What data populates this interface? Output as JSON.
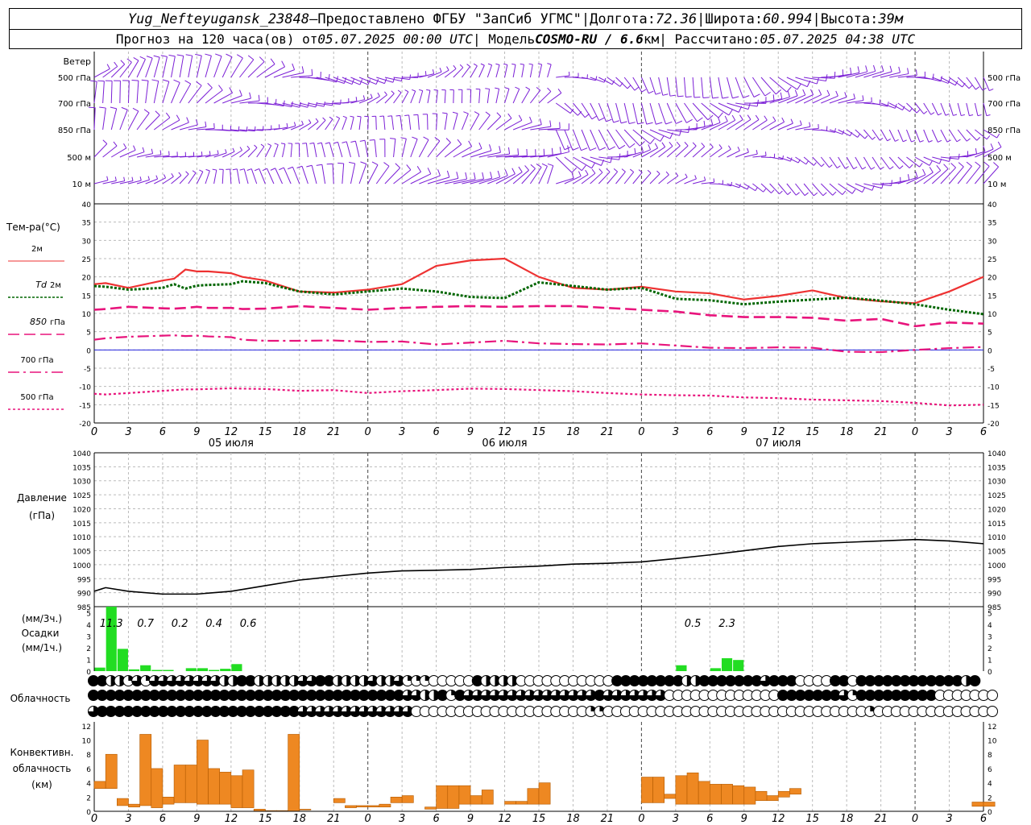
{
  "header": {
    "line1": {
      "station": "Yug_Nefteyugansk_23848",
      "dash": " – ",
      "provider": "Предоставлено ФГБУ \"ЗапСиб УГМС\"",
      "sep": " | ",
      "lon_label": "Долгота: ",
      "lon": "72.36",
      "lat_label": "Широта: ",
      "lat": "60.994",
      "alt_label": "Высота: ",
      "alt": "39м"
    },
    "line2": {
      "forecast_prefix": "Прогноз на 120 часа(ов) от ",
      "forecast_time": "05.07.2025 00:00 UTC",
      "model_prefix": "  | Модель ",
      "model": "COSMO-RU / 6.6",
      "model_unit": "км",
      "calc_prefix": " | Рассчитано: ",
      "calc_time": "05.07.2025 04:38 UTC"
    }
  },
  "colors": {
    "wind": "#7b1fd6",
    "t2m": "#ee3232",
    "td2m": "#006600",
    "t850": "#e8147c",
    "t700": "#e8147c",
    "t500": "#e8147c",
    "zero_line": "#2222dd",
    "precip": "#22dd22",
    "conv": "#ee8822"
  },
  "chart_data": {
    "type": "meteogram",
    "hour_ticks": [
      "0",
      "3",
      "6",
      "9",
      "12",
      "15",
      "18",
      "21",
      "0",
      "3",
      "6",
      "9",
      "12",
      "15",
      "18",
      "21",
      "0",
      "3",
      "6",
      "9",
      "12",
      "15",
      "18",
      "21",
      "0",
      "3",
      "6"
    ],
    "day_labels": [
      {
        "label": "05 июля",
        "hour": 12
      },
      {
        "label": "06 июля",
        "hour": 36
      },
      {
        "label": "07 июля",
        "hour": 60
      }
    ],
    "wind": {
      "title": "Ветер",
      "levels": [
        "500 гПа",
        "700 гПа",
        "850 гПа",
        "500 м",
        "10  м"
      ]
    },
    "temperature": {
      "title": "Тем-ра(°C)",
      "ylim": [
        -20,
        40
      ],
      "yticks": [
        "40",
        "35",
        "30",
        "25",
        "20",
        "15",
        "10",
        "5",
        "0",
        "-5",
        "-10",
        "-15",
        "-20"
      ],
      "legend": [
        {
          "label": "2м",
          "key": "t2m"
        },
        {
          "label_it": "Td",
          "label": "2м",
          "key": "td2m"
        },
        {
          "label_it": "850",
          "label": "гПа",
          "key": "t850"
        },
        {
          "label": "700 гПа",
          "key": "t700"
        },
        {
          "label": "500 гПа",
          "key": "t500"
        }
      ],
      "x_hours": [
        0,
        1,
        3,
        6,
        7,
        8,
        9,
        10,
        12,
        13,
        15,
        18,
        21,
        24,
        27,
        30,
        33,
        36,
        39,
        42,
        45,
        48,
        51,
        54,
        57,
        60,
        63,
        66,
        69,
        72,
        75,
        78
      ],
      "series": [
        {
          "key": "t2m",
          "values": [
            18,
            18.3,
            17,
            19,
            19.5,
            22,
            21.5,
            21.5,
            21,
            20,
            19,
            16,
            15.7,
            16.5,
            18,
            23,
            24.5,
            25,
            20,
            17,
            16.5,
            17.3,
            16,
            15.5,
            13.8,
            14.8,
            16.3,
            14.2,
            13.3,
            12.8,
            16,
            20
          ]
        },
        {
          "key": "td2m",
          "values": [
            17.5,
            17.3,
            16.5,
            17,
            18,
            16.8,
            17.6,
            17.8,
            18,
            18.8,
            18.3,
            16,
            15.2,
            16,
            16.8,
            16,
            14.5,
            14.2,
            18.5,
            17.5,
            16.5,
            17,
            14,
            13.6,
            12.5,
            13.2,
            13.8,
            14.3,
            13.5,
            12.5,
            11,
            9.8
          ]
        },
        {
          "key": "t850",
          "values": [
            11,
            11.2,
            11.8,
            11.4,
            11.3,
            11.5,
            11.8,
            11.5,
            11.5,
            11.2,
            11.3,
            12,
            11.5,
            11,
            11.5,
            11.8,
            12,
            11.8,
            12,
            12,
            11.5,
            11,
            10.5,
            9.5,
            9,
            9,
            8.8,
            8,
            8.5,
            6.5,
            7.5,
            7.2
          ]
        },
        {
          "key": "t700",
          "values": [
            2.8,
            3.2,
            3.6,
            3.9,
            4,
            3.8,
            3.9,
            3.7,
            3.5,
            2.8,
            2.5,
            2.5,
            2.6,
            2.2,
            2.3,
            1.5,
            2,
            2.5,
            1.8,
            1.6,
            1.5,
            1.8,
            1.2,
            0.6,
            0.5,
            0.7,
            0.6,
            -0.5,
            -0.6,
            0,
            0.5,
            0.8
          ]
        },
        {
          "key": "t500",
          "values": [
            -12,
            -12.2,
            -11.8,
            -11.2,
            -11,
            -10.8,
            -10.8,
            -10.7,
            -10.5,
            -10.6,
            -10.7,
            -11.2,
            -11,
            -11.8,
            -11.3,
            -11,
            -10.6,
            -10.7,
            -11,
            -11.3,
            -11.8,
            -12.2,
            -12.4,
            -12.5,
            -13,
            -13.2,
            -13.6,
            -13.8,
            -14,
            -14.5,
            -15.2,
            -15
          ]
        }
      ]
    },
    "pressure": {
      "title": "Давление",
      "unit": "(гПа)",
      "ylim": [
        985,
        1040
      ],
      "yticks": [
        "1040",
        "1035",
        "1030",
        "1025",
        "1020",
        "1015",
        "1010",
        "1005",
        "1000",
        "995",
        "990",
        "985"
      ],
      "x_hours": [
        0,
        1,
        3,
        6,
        9,
        12,
        15,
        18,
        21,
        24,
        27,
        30,
        33,
        36,
        39,
        42,
        45,
        48,
        51,
        54,
        57,
        60,
        63,
        66,
        69,
        72,
        75,
        78
      ],
      "values": [
        990.5,
        991.8,
        990.5,
        989.5,
        989.5,
        990.5,
        992.5,
        994.5,
        995.8,
        997,
        997.8,
        998,
        998.3,
        999,
        999.5,
        1000.2,
        1000.5,
        1001,
        1002.2,
        1003.5,
        1005,
        1006.5,
        1007.5,
        1008,
        1008.5,
        1009,
        1008.5,
        1007.5
      ]
    },
    "precipitation": {
      "title": "Осадки",
      "unit3": "(мм/3ч.)",
      "unit1": "(мм/1ч.)",
      "ylim": [
        0,
        5.5
      ],
      "yticks": [
        "5",
        "4",
        "3",
        "2",
        "1",
        "0"
      ],
      "totals": [
        {
          "hour": 1.5,
          "label": "11.3"
        },
        {
          "hour": 4.5,
          "label": "0.7"
        },
        {
          "hour": 7.5,
          "label": "0.2"
        },
        {
          "hour": 10.5,
          "label": "0.4"
        },
        {
          "hour": 13.5,
          "label": "0.6"
        },
        {
          "hour": 52.5,
          "label": "0.5"
        },
        {
          "hour": 55.5,
          "label": "2.3"
        }
      ],
      "hourly": [
        0.3,
        5.5,
        1.9,
        0.15,
        0.5,
        0.1,
        0.1,
        0,
        0.25,
        0.25,
        0.1,
        0.2,
        0.6,
        0,
        0,
        0,
        0,
        0,
        0,
        0,
        0,
        0,
        0,
        0,
        0,
        0,
        0,
        0,
        0,
        0,
        0,
        0,
        0,
        0,
        0,
        0,
        0,
        0,
        0,
        0,
        0,
        0,
        0,
        0,
        0,
        0,
        0,
        0,
        0,
        0,
        0,
        0.5,
        0,
        0,
        0.25,
        1.1,
        0.95,
        0,
        0,
        0,
        0,
        0,
        0,
        0,
        0,
        0,
        0,
        0,
        0,
        0,
        0,
        0,
        0,
        0,
        0,
        0,
        0,
        0
      ]
    },
    "cloudiness": {
      "title": "Облачность",
      "rows": [
        "FFHHQDQDDDDDDDDHHFFHHHHHDDFFHHHHDHHDQQQOOOOOFHHHHOOOOOOOOOOOFFFFFFFFHHFFFFFFFDFFFOOOOFFOFFFFFFFFFFFFHF",
        "FFFFFFFFFFFFFFFFFFFFFFFFFFFFFFFFFFFFDDHHFQFDDDDDDDDDDDDDDDFDDDDDDDOOOOOOOOOOOOOFFFFFFFDQFFFFFFFFFOOOOOOOOO",
        "DFFFFFFFFFFFFFFFFFFFFFFFDDDDDDDDDDDDDOOOOOOOOOOOOOOOOOOOOQQOOOOOOOOOOOOOOOOOOOOOOOOOOOOOOQOOOOOOOOOOOOOO"
      ]
    },
    "convective": {
      "title1": "Конвективн.",
      "title2": "облачность",
      "unit": "(км)",
      "ylim": [
        0,
        13
      ],
      "yticks": [
        "12",
        "10",
        "8",
        "6",
        "4",
        "2",
        "0"
      ],
      "bars": [
        [
          0,
          3.2,
          4.2
        ],
        [
          1,
          3.2,
          8
        ],
        [
          2,
          0.8,
          1.8
        ],
        [
          3,
          0.6,
          1
        ],
        [
          4,
          0.8,
          10.8
        ],
        [
          5,
          0.5,
          6
        ],
        [
          6,
          1,
          2
        ],
        [
          7,
          1.2,
          6.5
        ],
        [
          8,
          1.2,
          6.5
        ],
        [
          9,
          1,
          10
        ],
        [
          10,
          1,
          6
        ],
        [
          11,
          1,
          5.5
        ],
        [
          12,
          0.5,
          5
        ],
        [
          13,
          0.5,
          5.8
        ],
        [
          14,
          0,
          0.3
        ],
        [
          15,
          0,
          0.1
        ],
        [
          16,
          0,
          0.1
        ],
        [
          17,
          0,
          10.8
        ],
        [
          18,
          0.2,
          0.3
        ],
        [
          21,
          1.2,
          1.8
        ],
        [
          22,
          0.5,
          0.8
        ],
        [
          23,
          0.6,
          0.8
        ],
        [
          24,
          0.6,
          0.8
        ],
        [
          25,
          0.6,
          1
        ],
        [
          26,
          1.2,
          2
        ],
        [
          27,
          1.2,
          2.2
        ],
        [
          29,
          0.3,
          0.6
        ],
        [
          30,
          0.4,
          3.6
        ],
        [
          31,
          0.4,
          3.6
        ],
        [
          32,
          1,
          3.6
        ],
        [
          33,
          1,
          2.2
        ],
        [
          34,
          1,
          3
        ],
        [
          36,
          1,
          1.4
        ],
        [
          37,
          1,
          1.4
        ],
        [
          38,
          1,
          3.2
        ],
        [
          39,
          1,
          4
        ],
        [
          48,
          1.2,
          4.8
        ],
        [
          49,
          1.2,
          4.8
        ],
        [
          50,
          1.8,
          2.4
        ],
        [
          51,
          1,
          5
        ],
        [
          52,
          1,
          5.4
        ],
        [
          53,
          1,
          4.2
        ],
        [
          54,
          1,
          3.8
        ],
        [
          55,
          1,
          3.8
        ],
        [
          56,
          1,
          3.6
        ],
        [
          57,
          1,
          3.4
        ],
        [
          58,
          1.5,
          2.8
        ],
        [
          59,
          1.5,
          2.2
        ],
        [
          60,
          2,
          2.8
        ],
        [
          61,
          2.4,
          3.2
        ],
        [
          77,
          0.7,
          1.3
        ],
        [
          78,
          0.7,
          1.3
        ]
      ]
    }
  }
}
